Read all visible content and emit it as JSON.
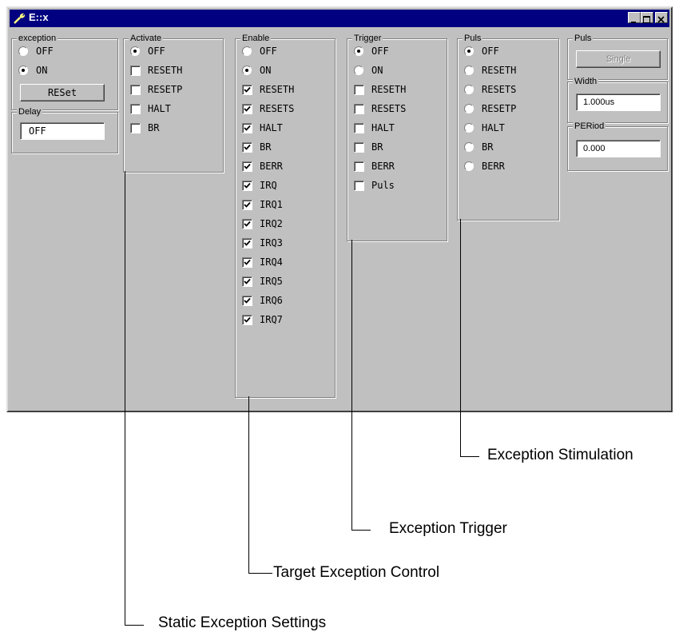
{
  "window": {
    "title": "E::x"
  },
  "groups": {
    "exception": {
      "title": "exception",
      "options": [
        {
          "label": "OFF",
          "selected": false
        },
        {
          "label": "ON",
          "selected": true
        }
      ],
      "reset_button": "RESet",
      "delay_title": "Delay",
      "delay_value": "OFF"
    },
    "activate": {
      "title": "Activate",
      "radios": [
        {
          "label": "OFF",
          "selected": true
        }
      ],
      "checks": [
        {
          "label": "RESETH",
          "checked": false
        },
        {
          "label": "RESETP",
          "checked": false
        },
        {
          "label": "HALT",
          "checked": false
        },
        {
          "label": "BR",
          "checked": false
        }
      ]
    },
    "enable": {
      "title": "Enable",
      "radios": [
        {
          "label": "OFF",
          "selected": false
        },
        {
          "label": "ON",
          "selected": true
        }
      ],
      "checks": [
        {
          "label": "RESETH",
          "checked": true
        },
        {
          "label": "RESETS",
          "checked": true
        },
        {
          "label": "HALT",
          "checked": true
        },
        {
          "label": "BR",
          "checked": true
        },
        {
          "label": "BERR",
          "checked": true
        },
        {
          "label": "IRQ",
          "checked": true
        },
        {
          "label": "IRQ1",
          "checked": true
        },
        {
          "label": "IRQ2",
          "checked": true
        },
        {
          "label": "IRQ3",
          "checked": true
        },
        {
          "label": "IRQ4",
          "checked": true
        },
        {
          "label": "IRQ5",
          "checked": true
        },
        {
          "label": "IRQ6",
          "checked": true
        },
        {
          "label": "IRQ7",
          "checked": true
        }
      ]
    },
    "trigger": {
      "title": "Trigger",
      "radios": [
        {
          "label": "OFF",
          "selected": true
        },
        {
          "label": "ON",
          "selected": false
        }
      ],
      "checks": [
        {
          "label": "RESETH",
          "checked": false
        },
        {
          "label": "RESETS",
          "checked": false
        },
        {
          "label": "HALT",
          "checked": false
        },
        {
          "label": "BR",
          "checked": false
        },
        {
          "label": "BERR",
          "checked": false
        },
        {
          "label": "Puls",
          "checked": false
        }
      ]
    },
    "puls": {
      "title": "Puls",
      "radios": [
        {
          "label": "OFF",
          "selected": true
        },
        {
          "label": "RESETH",
          "selected": false
        },
        {
          "label": "RESETS",
          "selected": false
        },
        {
          "label": "RESETP",
          "selected": false
        },
        {
          "label": "HALT",
          "selected": false
        },
        {
          "label": "BR",
          "selected": false
        },
        {
          "label": "BERR",
          "selected": false
        }
      ]
    },
    "puls2": {
      "title": "Puls",
      "single_button": "Single",
      "width_title": "Width",
      "width_value": "1.000us",
      "period_title": "PERiod",
      "period_value": "0.000"
    }
  },
  "callouts": [
    "Exception Stimulation",
    "Exception Trigger",
    "Target Exception Control",
    "Static Exception Settings"
  ],
  "colors": {
    "face": "#c0c0c0",
    "titlebar": "#000080"
  }
}
